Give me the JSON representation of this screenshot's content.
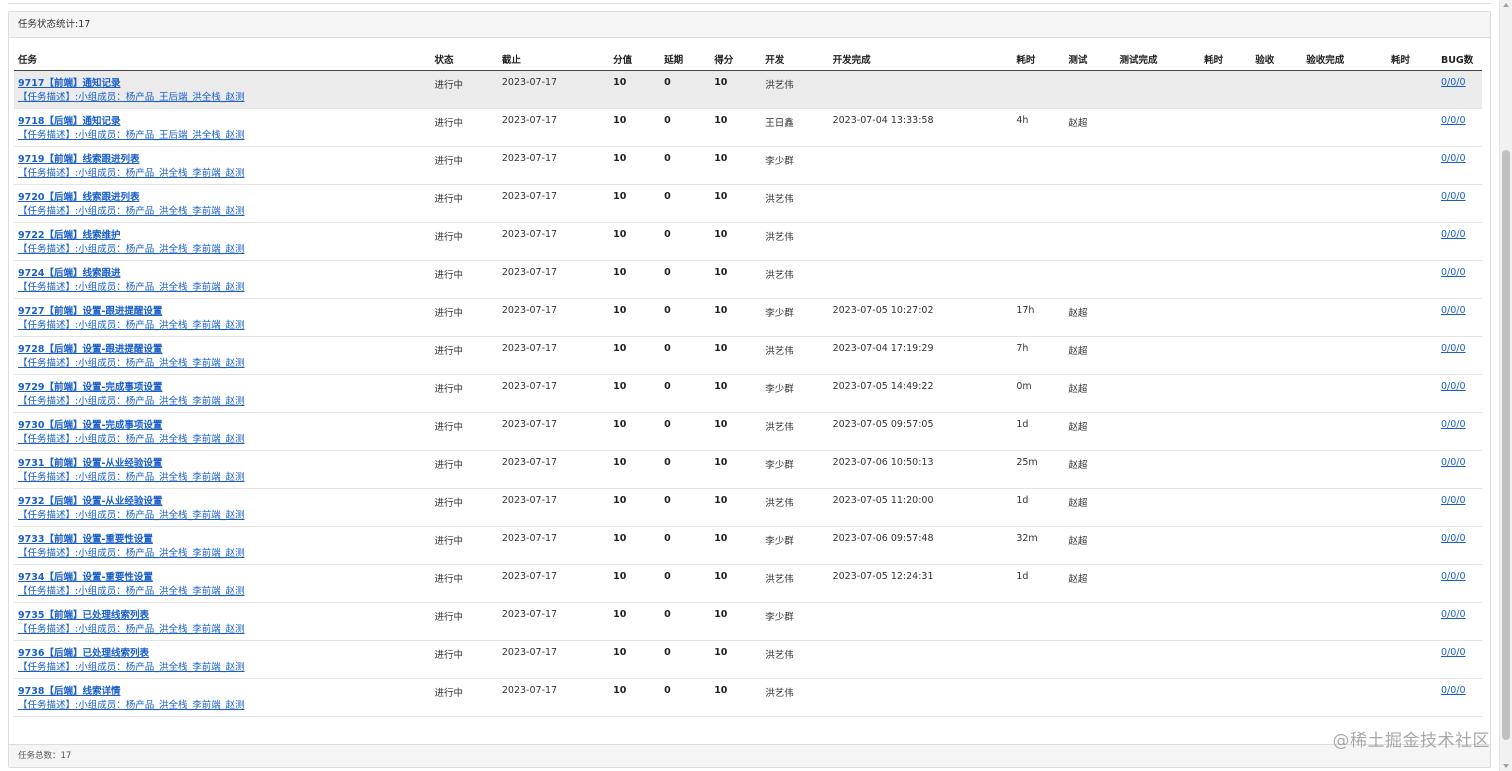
{
  "panel": {
    "heading": "任务状态统计:17",
    "footer": "任务总数：17"
  },
  "columns": [
    "任务",
    "状态",
    "截止",
    "分值",
    "延期",
    "得分",
    "开发",
    "开发完成",
    "耗时",
    "测试",
    "测试完成",
    "耗时",
    "验收",
    "验收完成",
    "耗时",
    "BUG数"
  ],
  "rows": [
    {
      "title": "9717【前端】通知记录",
      "desc": "【任务描述】:小组成员：杨产品_王后端_洪全栈_赵测",
      "status": "进行中",
      "deadline": "2023-07-17",
      "score": "10",
      "delay": "0",
      "points": "10",
      "dev": "洪艺伟",
      "dev_done": "",
      "dev_time": "",
      "tester": "",
      "test_done": "",
      "test_time": "",
      "accept": "",
      "accept_done": "",
      "accept_time": "",
      "bugs": "0/0/0"
    },
    {
      "title": "9718【后端】通知记录",
      "desc": "【任务描述】:小组成员：杨产品_王后端_洪全栈_赵测",
      "status": "进行中",
      "deadline": "2023-07-17",
      "score": "10",
      "delay": "0",
      "points": "10",
      "dev": "王日鑫",
      "dev_done": "2023-07-04 13:33:58",
      "dev_time": "4h",
      "tester": "赵超",
      "test_done": "",
      "test_time": "",
      "accept": "",
      "accept_done": "",
      "accept_time": "",
      "bugs": "0/0/0"
    },
    {
      "title": "9719【前端】线索跟进列表",
      "desc": "【任务描述】:小组成员：杨产品_洪全栈_李前端_赵测",
      "status": "进行中",
      "deadline": "2023-07-17",
      "score": "10",
      "delay": "0",
      "points": "10",
      "dev": "李少群",
      "dev_done": "",
      "dev_time": "",
      "tester": "",
      "test_done": "",
      "test_time": "",
      "accept": "",
      "accept_done": "",
      "accept_time": "",
      "bugs": "0/0/0"
    },
    {
      "title": "9720【后端】线索跟进列表",
      "desc": "【任务描述】:小组成员：杨产品_洪全栈_李前端_赵测",
      "status": "进行中",
      "deadline": "2023-07-17",
      "score": "10",
      "delay": "0",
      "points": "10",
      "dev": "洪艺伟",
      "dev_done": "",
      "dev_time": "",
      "tester": "",
      "test_done": "",
      "test_time": "",
      "accept": "",
      "accept_done": "",
      "accept_time": "",
      "bugs": "0/0/0"
    },
    {
      "title": "9722【后端】线索维护",
      "desc": "【任务描述】:小组成员：杨产品_洪全栈_李前端_赵测",
      "status": "进行中",
      "deadline": "2023-07-17",
      "score": "10",
      "delay": "0",
      "points": "10",
      "dev": "洪艺伟",
      "dev_done": "",
      "dev_time": "",
      "tester": "",
      "test_done": "",
      "test_time": "",
      "accept": "",
      "accept_done": "",
      "accept_time": "",
      "bugs": "0/0/0"
    },
    {
      "title": "9724【后端】线索跟进",
      "desc": "【任务描述】:小组成员：杨产品_洪全栈_李前端_赵测",
      "status": "进行中",
      "deadline": "2023-07-17",
      "score": "10",
      "delay": "0",
      "points": "10",
      "dev": "洪艺伟",
      "dev_done": "",
      "dev_time": "",
      "tester": "",
      "test_done": "",
      "test_time": "",
      "accept": "",
      "accept_done": "",
      "accept_time": "",
      "bugs": "0/0/0"
    },
    {
      "title": "9727【前端】设置-跟进提醒设置",
      "desc": "【任务描述】:小组成员：杨产品_洪全栈_李前端_赵测",
      "status": "进行中",
      "deadline": "2023-07-17",
      "score": "10",
      "delay": "0",
      "points": "10",
      "dev": "李少群",
      "dev_done": "2023-07-05 10:27:02",
      "dev_time": "17h",
      "tester": "赵超",
      "test_done": "",
      "test_time": "",
      "accept": "",
      "accept_done": "",
      "accept_time": "",
      "bugs": "0/0/0"
    },
    {
      "title": "9728【后端】设置-跟进提醒设置",
      "desc": "【任务描述】:小组成员：杨产品_洪全栈_李前端_赵测",
      "status": "进行中",
      "deadline": "2023-07-17",
      "score": "10",
      "delay": "0",
      "points": "10",
      "dev": "洪艺伟",
      "dev_done": "2023-07-04 17:19:29",
      "dev_time": "7h",
      "tester": "赵超",
      "test_done": "",
      "test_time": "",
      "accept": "",
      "accept_done": "",
      "accept_time": "",
      "bugs": "0/0/0"
    },
    {
      "title": "9729【前端】设置-完成事项设置",
      "desc": "【任务描述】:小组成员：杨产品_洪全栈_李前端_赵测",
      "status": "进行中",
      "deadline": "2023-07-17",
      "score": "10",
      "delay": "0",
      "points": "10",
      "dev": "李少群",
      "dev_done": "2023-07-05 14:49:22",
      "dev_time": "0m",
      "tester": "赵超",
      "test_done": "",
      "test_time": "",
      "accept": "",
      "accept_done": "",
      "accept_time": "",
      "bugs": "0/0/0"
    },
    {
      "title": "9730【后端】设置-完成事项设置",
      "desc": "【任务描述】:小组成员：杨产品_洪全栈_李前端_赵测",
      "status": "进行中",
      "deadline": "2023-07-17",
      "score": "10",
      "delay": "0",
      "points": "10",
      "dev": "洪艺伟",
      "dev_done": "2023-07-05 09:57:05",
      "dev_time": "1d",
      "tester": "赵超",
      "test_done": "",
      "test_time": "",
      "accept": "",
      "accept_done": "",
      "accept_time": "",
      "bugs": "0/0/0"
    },
    {
      "title": "9731【前端】设置-从业经验设置",
      "desc": "【任务描述】:小组成员：杨产品_洪全栈_李前端_赵测",
      "status": "进行中",
      "deadline": "2023-07-17",
      "score": "10",
      "delay": "0",
      "points": "10",
      "dev": "李少群",
      "dev_done": "2023-07-06 10:50:13",
      "dev_time": "25m",
      "tester": "赵超",
      "test_done": "",
      "test_time": "",
      "accept": "",
      "accept_done": "",
      "accept_time": "",
      "bugs": "0/0/0"
    },
    {
      "title": "9732【后端】设置-从业经验设置",
      "desc": "【任务描述】:小组成员：杨产品_洪全栈_李前端_赵测",
      "status": "进行中",
      "deadline": "2023-07-17",
      "score": "10",
      "delay": "0",
      "points": "10",
      "dev": "洪艺伟",
      "dev_done": "2023-07-05 11:20:00",
      "dev_time": "1d",
      "tester": "赵超",
      "test_done": "",
      "test_time": "",
      "accept": "",
      "accept_done": "",
      "accept_time": "",
      "bugs": "0/0/0"
    },
    {
      "title": "9733【前端】设置-重要性设置",
      "desc": "【任务描述】:小组成员：杨产品_洪全栈_李前端_赵测",
      "status": "进行中",
      "deadline": "2023-07-17",
      "score": "10",
      "delay": "0",
      "points": "10",
      "dev": "李少群",
      "dev_done": "2023-07-06 09:57:48",
      "dev_time": "32m",
      "tester": "赵超",
      "test_done": "",
      "test_time": "",
      "accept": "",
      "accept_done": "",
      "accept_time": "",
      "bugs": "0/0/0"
    },
    {
      "title": "9734【后端】设置-重要性设置",
      "desc": "【任务描述】:小组成员：杨产品_洪全栈_李前端_赵测",
      "status": "进行中",
      "deadline": "2023-07-17",
      "score": "10",
      "delay": "0",
      "points": "10",
      "dev": "洪艺伟",
      "dev_done": "2023-07-05 12:24:31",
      "dev_time": "1d",
      "tester": "赵超",
      "test_done": "",
      "test_time": "",
      "accept": "",
      "accept_done": "",
      "accept_time": "",
      "bugs": "0/0/0"
    },
    {
      "title": "9735【前端】已处理线索列表",
      "desc": "【任务描述】:小组成员：杨产品_洪全栈_李前端_赵测",
      "status": "进行中",
      "deadline": "2023-07-17",
      "score": "10",
      "delay": "0",
      "points": "10",
      "dev": "李少群",
      "dev_done": "",
      "dev_time": "",
      "tester": "",
      "test_done": "",
      "test_time": "",
      "accept": "",
      "accept_done": "",
      "accept_time": "",
      "bugs": "0/0/0"
    },
    {
      "title": "9736【后端】已处理线索列表",
      "desc": "【任务描述】:小组成员：杨产品_洪全栈_李前端_赵测",
      "status": "进行中",
      "deadline": "2023-07-17",
      "score": "10",
      "delay": "0",
      "points": "10",
      "dev": "洪艺伟",
      "dev_done": "",
      "dev_time": "",
      "tester": "",
      "test_done": "",
      "test_time": "",
      "accept": "",
      "accept_done": "",
      "accept_time": "",
      "bugs": "0/0/0"
    },
    {
      "title": "9738【后端】线索详情",
      "desc": "【任务描述】:小组成员：杨产品_洪全栈_李前端_赵测",
      "status": "进行中",
      "deadline": "2023-07-17",
      "score": "10",
      "delay": "0",
      "points": "10",
      "dev": "洪艺伟",
      "dev_done": "",
      "dev_time": "",
      "tester": "",
      "test_done": "",
      "test_time": "",
      "accept": "",
      "accept_done": "",
      "accept_time": "",
      "bugs": "0/0/0"
    }
  ],
  "watermark": "@稀土掘金技术社区",
  "colors": {
    "link": "#1a5fc9",
    "hover_row": "#ebebeb",
    "panel_bg": "#f5f5f5"
  }
}
